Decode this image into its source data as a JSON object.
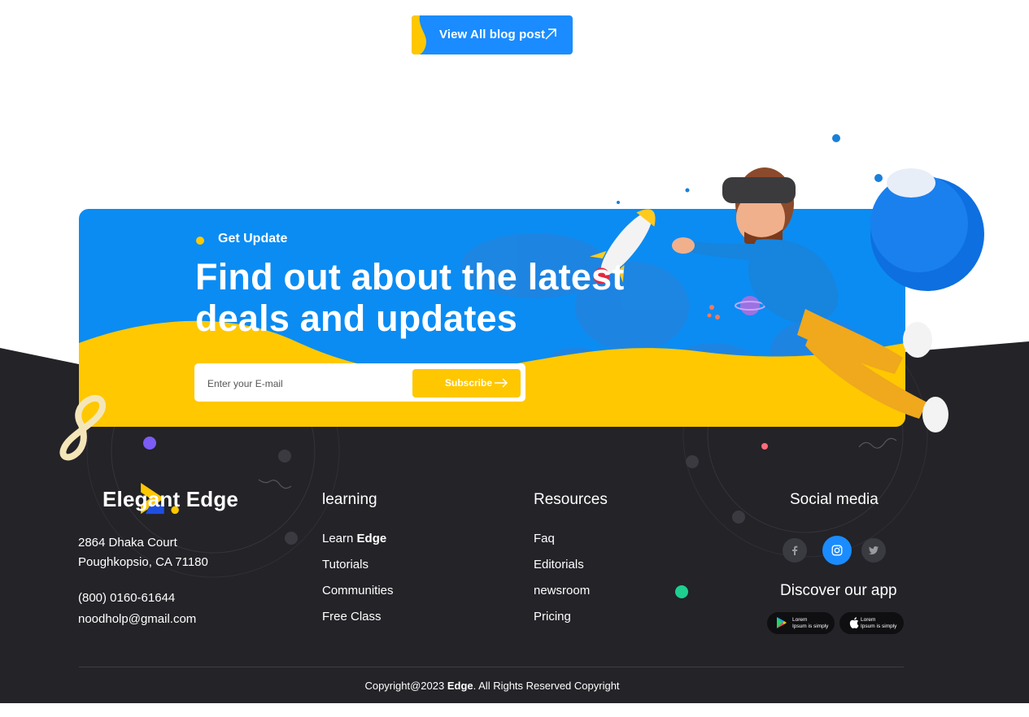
{
  "blog_button": {
    "label": "View All blog post",
    "icon": "arrow-up-right-icon"
  },
  "newsletter": {
    "tag": "Get Update",
    "headline_line1": "Find out about the latest",
    "headline_line2": "deals and updates",
    "email_placeholder": "Enter your E-mail",
    "subscribe_label": "Subscribe"
  },
  "footer": {
    "brand": "Elegant Edge",
    "address_line1": "2864 Dhaka Court",
    "address_line2": "Poughkopsio, CA 71180",
    "phone": "(800) 0160-61644",
    "email": "noodholp@gmail.com",
    "learning": {
      "title": "learning",
      "link1_prefix": "Learn ",
      "link1_bold": "Edge",
      "link2": "Tutorials",
      "link3": "Communities",
      "link4": "Free Class"
    },
    "resources": {
      "title": "Resources",
      "links": [
        "Faq",
        "Editorials",
        "newsroom",
        "Pricing"
      ]
    },
    "social": {
      "title": "Social media",
      "icons": [
        "facebook-icon",
        "instagram-icon",
        "twitter-icon"
      ],
      "app_title": "Discover our app",
      "badge_line1": "Lorem",
      "badge_line2": "Ipsum is simply"
    },
    "copyright_prefix": "Copyright@2023 ",
    "copyright_bold": "Edge",
    "copyright_suffix": ". All Rights Reserved Copyright"
  },
  "colors": {
    "primary_blue": "#1a8cff",
    "accent_yellow": "#ffc700",
    "footer_dark": "#232328",
    "white": "#ffffff"
  }
}
